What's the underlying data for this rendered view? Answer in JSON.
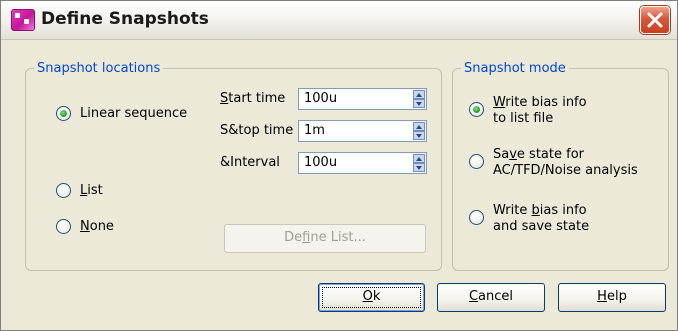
{
  "window": {
    "title": "Define Snapshots"
  },
  "snapshot_locations": {
    "legend": "Snapshot locations",
    "options": [
      {
        "pre": "Linear sequence",
        "key": "",
        "post": "",
        "selected": true
      },
      {
        "pre": "",
        "key": "L",
        "post": "ist",
        "selected": false
      },
      {
        "pre": "",
        "key": "N",
        "post": "one",
        "selected": false
      }
    ],
    "fields": [
      {
        "pre": "",
        "key": "S",
        "post": "tart time",
        "value": "100u"
      },
      {
        "pre": "S&top time",
        "key": "",
        "post": "",
        "value": "1m"
      },
      {
        "pre": "&Interval",
        "key": "",
        "post": "",
        "value": "100u"
      }
    ],
    "define_list": {
      "pre": "De",
      "key": "f",
      "post": "ine List..."
    }
  },
  "snapshot_mode": {
    "legend": "Snapshot mode",
    "options": [
      {
        "line1_pre": "",
        "line1_key": "W",
        "line1_post": "rite bias info",
        "line2": "to list file",
        "selected": true
      },
      {
        "line1_pre": "Sa",
        "line1_key": "v",
        "line1_post": "e state for",
        "line2": "AC/TFD/Noise analysis",
        "selected": false
      },
      {
        "line1_pre": "Write ",
        "line1_key": "b",
        "line1_post": "ias info",
        "line2": "and save state",
        "selected": false
      }
    ]
  },
  "buttons": {
    "ok": {
      "pre": "",
      "key": "O",
      "post": "k"
    },
    "cancel": {
      "pre": "",
      "key": "C",
      "post": "ancel"
    },
    "help": {
      "pre": "",
      "key": "H",
      "post": "elp"
    }
  },
  "colors": {
    "group_legend": "#0046d5",
    "dialog_bg": "#ece9d8",
    "radio_dot": "#2aa52a"
  }
}
